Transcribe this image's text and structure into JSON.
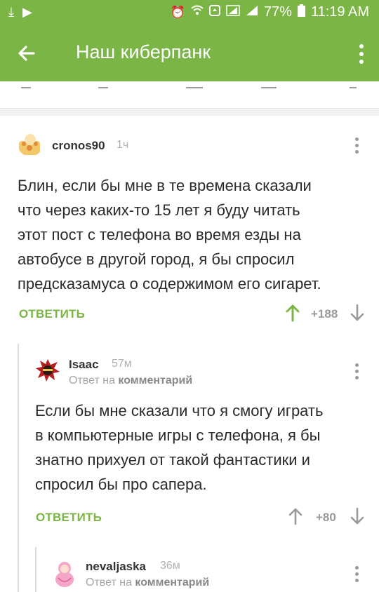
{
  "status_bar": {
    "battery": "77%",
    "time": "11:19 AM"
  },
  "app_bar": {
    "title": "Наш киберпанк"
  },
  "comments": [
    {
      "user": "cronos90",
      "time": "1ч",
      "text_lines": [
        "Блин, если бы мне в те времена сказали",
        "что через каких-то 15 лет я буду читать",
        "этот пост с телефона во время езды на",
        "автобусе в другой город, я бы спросил",
        "предсказамуса о содержимом его сигарет."
      ],
      "reply_label": "ОТВЕТИТЬ",
      "score": "+188"
    },
    {
      "user": "Isaac",
      "time": "57м",
      "reply_to_prefix": "Ответ на",
      "reply_to_link": "комментарий",
      "text_lines": [
        "Если бы мне сказали что я смогу играть",
        "в компьютерные игры с телефона, я бы",
        "знатно прихуел от такой фантастики и",
        "спросил бы про сапера."
      ],
      "reply_label": "ОТВЕТИТЬ",
      "score": "+80"
    },
    {
      "user": "nevaljaska",
      "time": "36м",
      "reply_to_prefix": "Ответ на",
      "reply_to_link": "комментарий"
    }
  ],
  "colors": {
    "accent": "#7ab545",
    "text": "#2a2a2a",
    "muted": "#9a9a9a"
  }
}
